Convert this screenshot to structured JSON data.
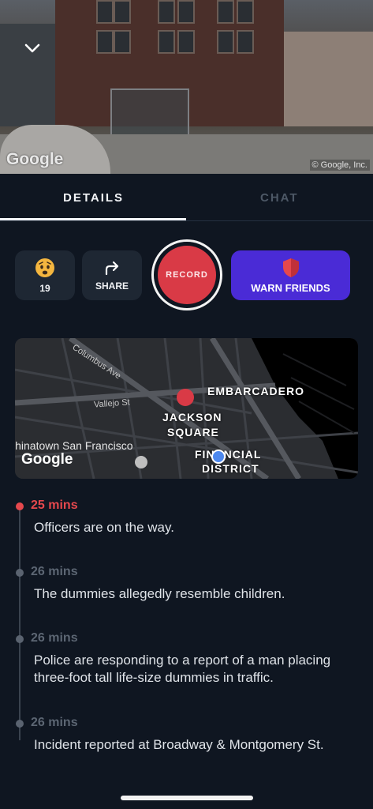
{
  "street_view": {
    "watermark": "Google",
    "copyright": "© Google, Inc.",
    "collapse_icon": "chevron-down-icon"
  },
  "tabs": [
    {
      "label": "DETAILS",
      "active": true
    },
    {
      "label": "CHAT",
      "active": false
    }
  ],
  "actions": {
    "reaction_icon": "worried-face-emoji",
    "reaction_count": "19",
    "share_label": "SHARE",
    "share_icon": "share-arrow-icon",
    "record_label": "RECORD",
    "warn_label": "WARN FRIENDS",
    "warn_icon": "shield-icon"
  },
  "map": {
    "labels": {
      "embarcadero": "EMBARCADERO",
      "jackson": "JACKSON",
      "square": "SQUARE",
      "financial": "FINANCIAL",
      "district": "DISTRICT"
    },
    "streets": {
      "columbus": "Columbus Ave",
      "vallejo": "Vallejo St"
    },
    "chinatown": "Chinatown San Francisco",
    "watermark": "Google"
  },
  "timeline": [
    {
      "time": "25 mins",
      "text": "Officers are on the way.",
      "active": true
    },
    {
      "time": "26 mins",
      "text": "The dummies allegedly resemble children.",
      "active": false
    },
    {
      "time": "26 mins",
      "text": "Police are responding to a report of a man placing three-foot tall life-size dummies in traffic.",
      "active": false
    },
    {
      "time": "26 mins",
      "text": "Incident reported at Broadway & Montgomery St.",
      "active": false
    }
  ],
  "colors": {
    "background": "#0f1621",
    "accent_red": "#d93a46",
    "warn_purple": "#4a2bd6",
    "card": "#1e2733"
  }
}
